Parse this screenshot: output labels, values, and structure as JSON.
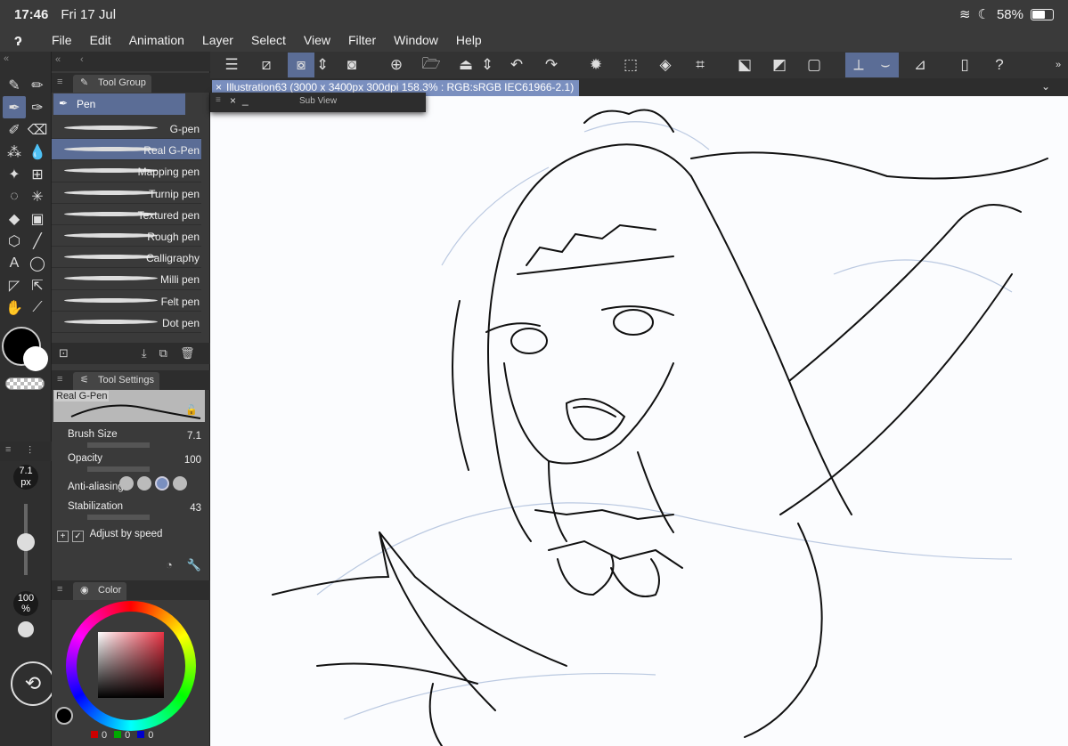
{
  "status": {
    "time": "17:46",
    "date": "Fri 17 Jul",
    "battery": "58%",
    "battery_level": 0.58
  },
  "menu": [
    "File",
    "Edit",
    "Animation",
    "Layer",
    "Select",
    "View",
    "Filter",
    "Window",
    "Help"
  ],
  "tool_group": {
    "title": "Tool Group",
    "active": "Pen"
  },
  "brushes": [
    "G-pen",
    "Real G-Pen",
    "Mapping pen",
    "Turnip pen",
    "Textured pen",
    "Rough pen",
    "Calligraphy",
    "Milli pen",
    "Felt pen",
    "Dot pen"
  ],
  "active_brush_index": 1,
  "tool_settings": {
    "title": "Tool Settings",
    "preset": "Real G-Pen",
    "brush_size_label": "Brush Size",
    "brush_size": "7.1",
    "opacity_label": "Opacity",
    "opacity": "100",
    "antialias_label": "Anti-aliasing",
    "stabilization_label": "Stabilization",
    "stabilization": "43",
    "adjust_label": "Adjust by speed"
  },
  "left": {
    "size_value": "7.1",
    "size_unit": "px",
    "opacity_value": "100",
    "opacity_unit": "%"
  },
  "color": {
    "title": "Color",
    "r": "0",
    "g": "0",
    "b": "0",
    "main": "#000000",
    "sub": "#ffffff"
  },
  "document": {
    "title": "Illustration63 (3000 x 3400px 300dpi 158.3% : RGB:sRGB IEC61966-2.1)"
  },
  "subview": {
    "title": "Sub View"
  },
  "colors": {
    "accent": "#5b6d96",
    "doc_tab": "#7a8fbf"
  }
}
